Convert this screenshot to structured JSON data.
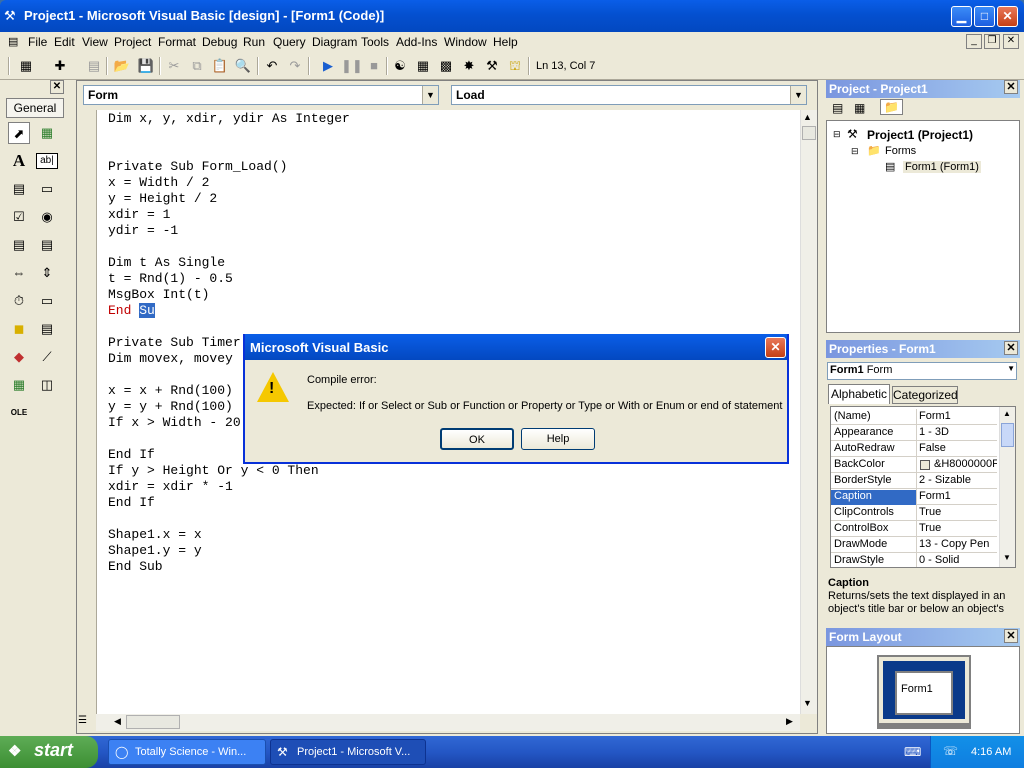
{
  "window": {
    "title": "Project1 - Microsoft Visual Basic [design] - [Form1 (Code)]",
    "min_glyph": "▁",
    "max_glyph": "□",
    "close_glyph": "✕"
  },
  "menubar": {
    "items": [
      "File",
      "Edit",
      "View",
      "Project",
      "Format",
      "Debug",
      "Run",
      "Query",
      "Diagram",
      "Tools",
      "Add-Ins",
      "Window",
      "Help"
    ],
    "mdi_min": "_",
    "mdi_restore": "❐",
    "mdi_close": "✕"
  },
  "toolbar": {
    "position": "Ln 13, Col 7"
  },
  "toolbox": {
    "tab_label": "General",
    "close_glyph": "✕"
  },
  "code_window": {
    "object_combo": "Form",
    "proc_combo": "Load",
    "lines": [
      "Dim x, y, xdir, ydir As Integer",
      "",
      "",
      "Private Sub Form_Load()",
      "x = Width / 2",
      "y = Height / 2",
      "xdir = 1",
      "ydir = -1",
      "",
      "Dim t As Single",
      "t = Rnd(1) - 0.5",
      "MsgBox Int(t)",
      "End Su",
      "",
      "Private Sub Timer",
      "Dim movex, movey",
      "",
      "x = x + Rnd(100)",
      "y = y + Rnd(100)",
      "If x > Width - 20",
      "",
      "End If",
      "If y > Height Or y < 0 Then",
      "xdir = xdir * -1",
      "End If",
      "",
      "Shape1.x = x",
      "Shape1.y = y",
      "End Sub"
    ],
    "error_line_prefix": "End ",
    "error_line_selected": "Su",
    "error_color": "#c00000",
    "selection_color": "#316ac5"
  },
  "project_panel": {
    "title": "Project - Project1",
    "root": "Project1 (Project1)",
    "folder": "Forms",
    "form": "Form1 (Form1)"
  },
  "properties_panel": {
    "title": "Properties - Form1",
    "object_name": "Form1",
    "object_type": "Form",
    "tabs": [
      "Alphabetic",
      "Categorized"
    ],
    "rows": [
      {
        "name": "(Name)",
        "value": "Form1"
      },
      {
        "name": "Appearance",
        "value": "1 - 3D"
      },
      {
        "name": "AutoRedraw",
        "value": "False"
      },
      {
        "name": "BackColor",
        "value": "&H8000000F"
      },
      {
        "name": "BorderStyle",
        "value": "2 - Sizable"
      },
      {
        "name": "Caption",
        "value": "Form1"
      },
      {
        "name": "ClipControls",
        "value": "True"
      },
      {
        "name": "ControlBox",
        "value": "True"
      },
      {
        "name": "DrawMode",
        "value": "13 - Copy Pen"
      },
      {
        "name": "DrawStyle",
        "value": "0 - Solid"
      }
    ],
    "selected_row": "Caption",
    "desc_title": "Caption",
    "desc_text": "Returns/sets the text displayed in an object's title bar or below an object's"
  },
  "form_layout": {
    "title": "Form Layout",
    "form_label": "Form1"
  },
  "dialog": {
    "title": "Microsoft Visual Basic",
    "heading": "Compile error:",
    "message": "Expected: If or Select or Sub or Function or Property or Type or With or Enum or end of statement",
    "ok_label": "OK",
    "help_label": "Help",
    "close_glyph": "✕",
    "warning_glyph": "!"
  },
  "taskbar": {
    "start_label": "start",
    "tasks": [
      "Totally Science - Win...",
      "Project1 - Microsoft V..."
    ],
    "clock": "4:16 AM"
  },
  "colors": {
    "xp_blue": "#0348c0",
    "panel_title": "#7a96df",
    "taskbar": "#2457c5"
  }
}
